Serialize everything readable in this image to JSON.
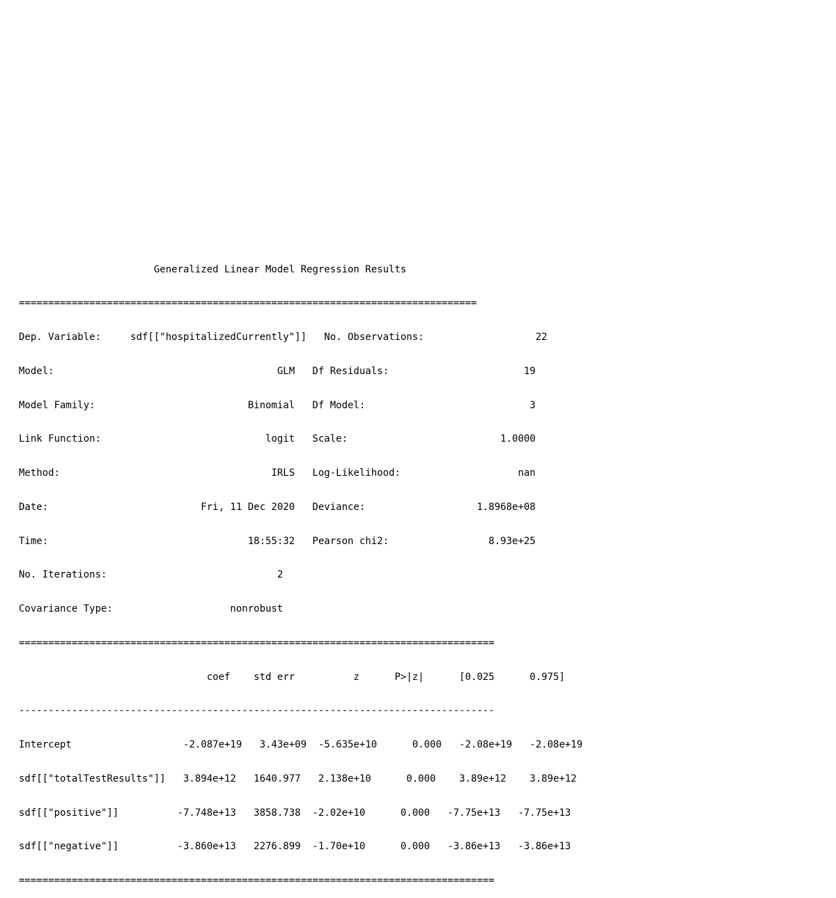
{
  "report": {
    "title_line": "                       Generalized Linear Model Regression Results",
    "rule_top": "==============================================================================",
    "info_lines": [
      "Dep. Variable:     sdf[[\"hospitalizedCurrently\"]]   No. Observations:                   22",
      "Model:                                      GLM   Df Residuals:                       19",
      "Model Family:                          Binomial   Df Model:                            3",
      "Link Function:                            logit   Scale:                          1.0000",
      "Method:                                    IRLS   Log-Likelihood:                    nan",
      "Date:                          Fri, 11 Dec 2020   Deviance:                   1.8968e+08",
      "Time:                                  18:55:32   Pearson chi2:                 8.93e+25",
      "No. Iterations:                             2                                          ",
      "Covariance Type:                    nonrobust                                          "
    ],
    "rule_mid": "=================================================================================",
    "coef_header": "                                coef    std err          z      P>|z|      [0.025      0.975]",
    "rule_dash": "---------------------------------------------------------------------------------",
    "coef_rows": [
      "Intercept                   -2.087e+19   3.43e+09  -5.635e+10      0.000   -2.08e+19   -2.08e+19",
      "sdf[[\"totalTestResults\"]]   3.894e+12   1640.977   2.138e+10      0.000    3.89e+12    3.89e+12",
      "sdf[[\"positive\"]]          -7.748e+13   3858.738  -2.02e+10      0.000   -7.75e+13   -7.75e+13",
      "sdf[[\"negative\"]]          -3.860e+13   2276.899  -1.70e+10      0.000   -3.86e+13   -3.86e+13"
    ],
    "rule_bottom": "================================================================================="
  }
}
